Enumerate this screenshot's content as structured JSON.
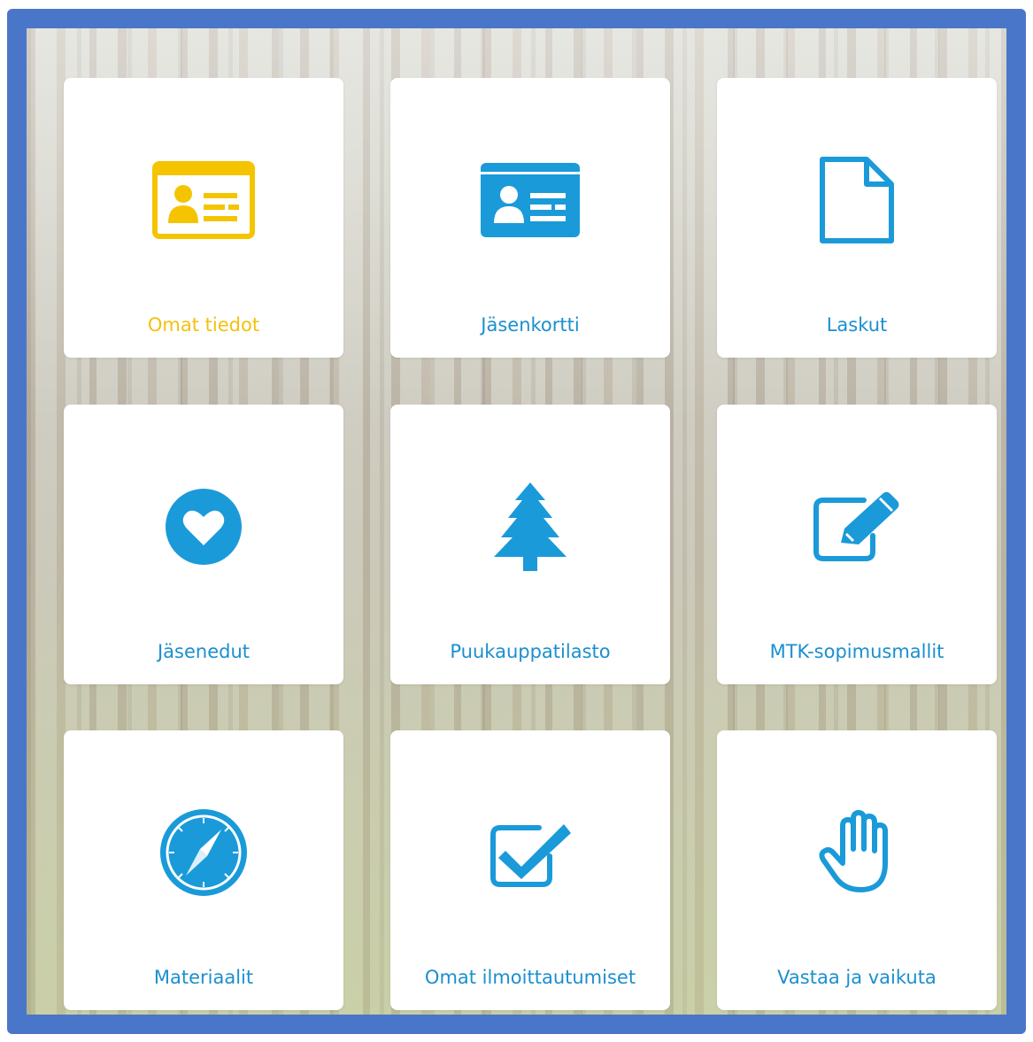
{
  "colors": {
    "frame_border": "#4a76c9",
    "accent_blue": "#1b8fcf",
    "icon_blue": "#1a9ad9",
    "active_yellow": "#f2c10f"
  },
  "tiles": [
    {
      "label": "Omat tiedot",
      "icon": "id-card-outline-icon",
      "active": true
    },
    {
      "label": "Jäsenkortti",
      "icon": "id-card-icon"
    },
    {
      "label": "Laskut",
      "icon": "document-icon"
    },
    {
      "label": "Jäsenedut",
      "icon": "heart-icon"
    },
    {
      "label": "Puukauppatilasto",
      "icon": "tree-icon"
    },
    {
      "label": "MTK-sopimusmallit",
      "icon": "edit-icon"
    },
    {
      "label": "Materiaalit",
      "icon": "compass-icon"
    },
    {
      "label": "Omat ilmoittautumiset",
      "icon": "checkbox-icon"
    },
    {
      "label": "Vastaa ja vaikuta",
      "icon": "hand-icon"
    }
  ]
}
